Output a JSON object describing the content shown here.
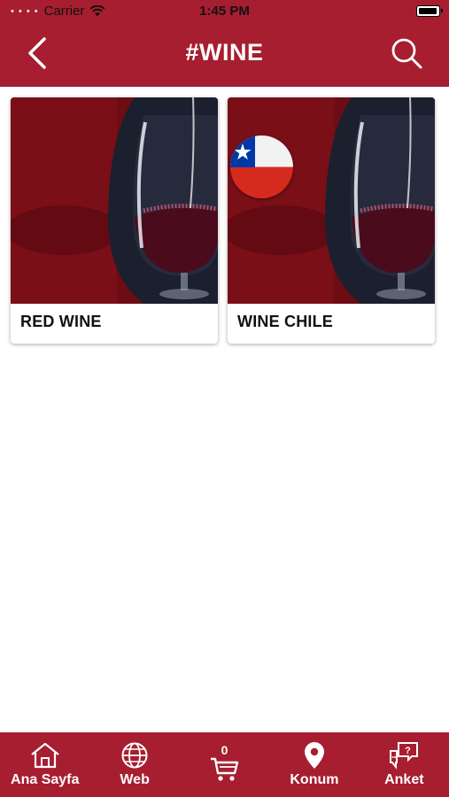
{
  "status": {
    "carrier": "Carrier",
    "time": "1:45 PM"
  },
  "header": {
    "title": "#WINE"
  },
  "cards": [
    {
      "label": "RED WINE"
    },
    {
      "label": "WINE CHILE"
    }
  ],
  "tabbar": {
    "home": "Ana Sayfa",
    "web": "Web",
    "cart_count": "0",
    "location": "Konum",
    "survey": "Anket"
  },
  "colors": {
    "brand": "#a61e30"
  },
  "icons": [
    "back-chevron-icon",
    "search-icon",
    "chile-flag-icon",
    "home-icon",
    "globe-icon",
    "cart-icon",
    "location-pin-icon",
    "survey-chat-icon"
  ]
}
